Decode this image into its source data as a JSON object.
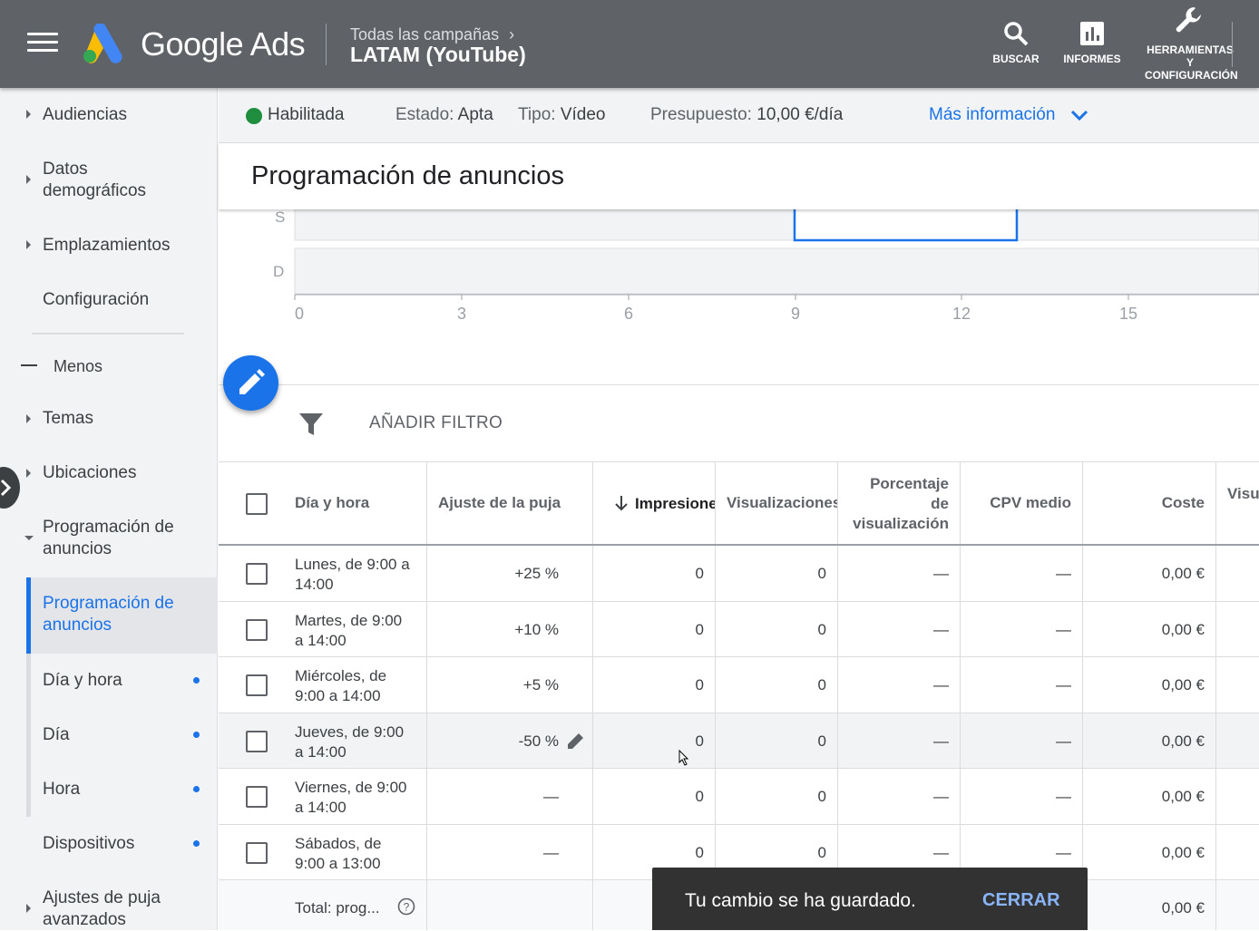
{
  "header": {
    "brand": "Google Ads",
    "breadcrumb_parent": "Todas las campañas",
    "breadcrumb_current": "LATAM (YouTube)",
    "search_label": "BUSCAR",
    "reports_label": "INFORMES",
    "tools_label_1": "HERRAMIENTAS",
    "tools_label_2": "Y",
    "tools_label_3": "CONFIGURACIÓN"
  },
  "sidebar": {
    "items": [
      {
        "label": "Audiencias"
      },
      {
        "label": "Datos",
        "label2": "demográficos"
      },
      {
        "label": "Emplazamientos"
      },
      {
        "label": "Configuración"
      },
      {
        "label": "Menos"
      },
      {
        "label": "Temas"
      },
      {
        "label": "Ubicaciones"
      },
      {
        "label": "Programación de",
        "label2": "anuncios"
      },
      {
        "label": "Programación de",
        "label2": "anuncios"
      },
      {
        "label": "Día y hora"
      },
      {
        "label": "Día"
      },
      {
        "label": "Hora"
      },
      {
        "label": "Dispositivos"
      },
      {
        "label": "Ajustes de puja",
        "label2": "avanzados"
      }
    ]
  },
  "status": {
    "state": "Habilitada",
    "estado_label": "Estado:",
    "estado_value": "Apta",
    "tipo_label": "Tipo:",
    "tipo_value": "Vídeo",
    "budget_label": "Presupuesto:",
    "budget_value": "10,00 €/día",
    "more": "Más información"
  },
  "page_title": "Programación de anuncios",
  "chart": {
    "rows": [
      "S",
      "D"
    ],
    "ticks": [
      "0",
      "3",
      "6",
      "9",
      "12",
      "15"
    ]
  },
  "filter": {
    "label": "AÑADIR FILTRO"
  },
  "table": {
    "headers": {
      "day_time": "Día y hora",
      "bid_adj": "Ajuste de la puja",
      "impressions": "Impresiones",
      "views": "Visualizaciones",
      "view_rate_1": "Porcentaje",
      "view_rate_2": "de",
      "view_rate_3": "visualización",
      "cpv": "CPV medio",
      "cost": "Coste",
      "extra": "Visu"
    },
    "rows": [
      {
        "day1": "Lunes, de 9:00 a",
        "day2": "14:00",
        "bid": "+25 %",
        "impr": "0",
        "views": "0",
        "rate": "—",
        "cpv": "—",
        "cost": "0,00 €"
      },
      {
        "day1": "Martes, de 9:00",
        "day2": "a 14:00",
        "bid": "+10 %",
        "impr": "0",
        "views": "0",
        "rate": "—",
        "cpv": "—",
        "cost": "0,00 €"
      },
      {
        "day1": "Miércoles, de",
        "day2": "9:00 a 14:00",
        "bid": "+5 %",
        "impr": "0",
        "views": "0",
        "rate": "—",
        "cpv": "—",
        "cost": "0,00 €"
      },
      {
        "day1": "Jueves, de 9:00",
        "day2": "a 14:00",
        "bid": "-50 %",
        "impr": "0",
        "views": "0",
        "rate": "—",
        "cpv": "—",
        "cost": "0,00 €"
      },
      {
        "day1": "Viernes, de 9:00",
        "day2": "a 14:00",
        "bid": "—",
        "impr": "0",
        "views": "0",
        "rate": "—",
        "cpv": "—",
        "cost": "0,00 €"
      },
      {
        "day1": "Sábados, de",
        "day2": "9:00 a 13:00",
        "bid": "—",
        "impr": "0",
        "views": "0",
        "rate": "—",
        "cpv": "—",
        "cost": "0,00 €"
      }
    ],
    "total_label": "Total: prog...",
    "total_cost": "0,00 €"
  },
  "snackbar": {
    "message": "Tu cambio se ha guardado.",
    "action": "CERRAR"
  }
}
